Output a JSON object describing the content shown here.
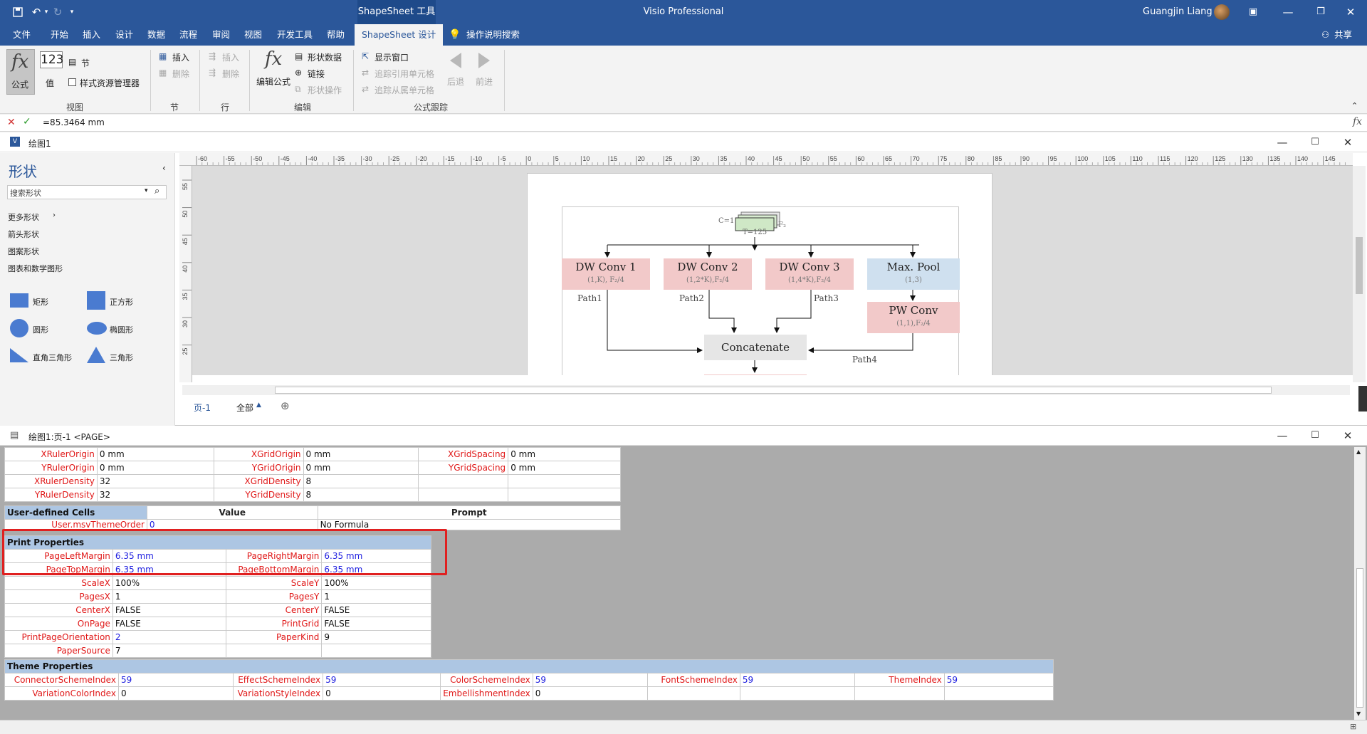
{
  "titlebar": {
    "context_tab": "ShapeSheet 工具",
    "app_title": "Visio Professional",
    "user_name": "Guangjin Liang"
  },
  "menu": {
    "items": [
      "文件",
      "开始",
      "插入",
      "设计",
      "数据",
      "流程",
      "审阅",
      "视图",
      "开发工具",
      "帮助"
    ],
    "active": "ShapeSheet 设计",
    "tell_me": "操作说明搜索",
    "share": "共享"
  },
  "ribbon": {
    "view_group": {
      "formula": "公式",
      "value_icon": "123",
      "value": "值",
      "section": "节",
      "style_explorer": "样式资源管理器",
      "label": "视图"
    },
    "section_group": {
      "insert": "插入",
      "delete": "删除",
      "label": "节"
    },
    "row_group": {
      "insert": "插入",
      "delete": "删除",
      "label": "行"
    },
    "edit_group": {
      "edit_formula": "编辑公式",
      "shape_data": "形状数据",
      "links": "链接",
      "shape_ops": "形状操作",
      "label": "编辑"
    },
    "trace_group": {
      "show_window": "显示窗口",
      "trace_precedents": "追踪引用单元格",
      "trace_dependents": "追踪从属单元格",
      "back": "后退",
      "forward": "前进",
      "label": "公式跟踪"
    }
  },
  "formula_bar": {
    "value": "=85.3464 mm"
  },
  "drawing_window": {
    "title": "绘图1",
    "shapes_panel": {
      "title": "形状",
      "search_placeholder": "搜索形状",
      "links": [
        "更多形状",
        "箭头形状",
        "图案形状",
        "图表和数学图形"
      ],
      "shapes": [
        "矩形",
        "正方形",
        "圆形",
        "椭圆形",
        "直角三角形",
        "三角形"
      ]
    },
    "ruler_labels": [
      "-60",
      "-55",
      "-50",
      "-45",
      "-40",
      "-35",
      "-30",
      "-25",
      "-20",
      "-15",
      "-10",
      "-5",
      "0",
      "5",
      "10",
      "15",
      "20",
      "25",
      "30",
      "35",
      "40",
      "45",
      "50",
      "55",
      "60",
      "65",
      "70",
      "75",
      "80",
      "85",
      "90",
      "95",
      "100",
      "105",
      "110",
      "115",
      "120",
      "125",
      "130",
      "135",
      "140",
      "145"
    ],
    "vruler_labels": [
      "55",
      "50",
      "45",
      "40",
      "35",
      "30",
      "25"
    ],
    "page_tabs": {
      "current": "页-1",
      "all": "全部"
    },
    "diagram": {
      "input_c": "C=1",
      "input_t": "T=125",
      "input_f": "F₂",
      "boxes": [
        {
          "title": "DW Conv 1",
          "sub": "(1,K), F₂/4"
        },
        {
          "title": "DW Conv 2",
          "sub": "(1,2*K),F₂/4"
        },
        {
          "title": "DW Conv 3",
          "sub": "(1,4*K),F₂/4"
        },
        {
          "title": "Max. Pool",
          "sub": "(1,3)"
        },
        {
          "title": "PW Conv",
          "sub": "(1,1),F₂/4"
        }
      ],
      "paths": [
        "Path1",
        "Path2",
        "Path3",
        "Path4"
      ],
      "concat": "Concatenate"
    }
  },
  "shapesheet": {
    "title": "绘图1:页-1 <PAGE>",
    "ruler_grid": [
      [
        "XRulerOrigin",
        "0 mm",
        "XGridOrigin",
        "0 mm",
        "XGridSpacing",
        "0 mm"
      ],
      [
        "YRulerOrigin",
        "0 mm",
        "YGridOrigin",
        "0 mm",
        "YGridSpacing",
        "0 mm"
      ],
      [
        "XRulerDensity",
        "32",
        "XGridDensity",
        "8",
        "",
        ""
      ],
      [
        "YRulerDensity",
        "32",
        "YGridDensity",
        "8",
        "",
        ""
      ]
    ],
    "user_defined": {
      "header": "User-defined Cells",
      "col_value": "Value",
      "col_prompt": "Prompt",
      "row": {
        "name": "User.msvThemeOrder",
        "value": "0",
        "prompt": "No Formula"
      }
    },
    "print_props": {
      "header": "Print Properties",
      "rows": [
        [
          "PageLeftMargin",
          "6.35 mm",
          "PageRightMargin",
          "6.35 mm"
        ],
        [
          "PageTopMargin",
          "6.35 mm",
          "PageBottomMargin",
          "6.35 mm"
        ],
        [
          "ScaleX",
          "100%",
          "ScaleY",
          "100%"
        ],
        [
          "PagesX",
          "1",
          "PagesY",
          "1"
        ],
        [
          "CenterX",
          "FALSE",
          "CenterY",
          "FALSE"
        ],
        [
          "OnPage",
          "FALSE",
          "PrintGrid",
          "FALSE"
        ],
        [
          "PrintPageOrientation",
          "2",
          "PaperKind",
          "9"
        ],
        [
          "PaperSource",
          "7",
          "",
          ""
        ]
      ],
      "blue_values": [
        [
          true,
          true
        ],
        [
          true,
          true
        ],
        [
          false,
          false
        ],
        [
          false,
          false
        ],
        [
          false,
          false
        ],
        [
          false,
          false
        ],
        [
          true,
          false
        ],
        [
          false,
          false
        ]
      ]
    },
    "theme_props": {
      "header": "Theme Properties",
      "rows": [
        [
          "ConnectorSchemeIndex",
          "59",
          "EffectSchemeIndex",
          "59",
          "ColorSchemeIndex",
          "59",
          "FontSchemeIndex",
          "59",
          "ThemeIndex",
          "59"
        ],
        [
          "VariationColorIndex",
          "0",
          "VariationStyleIndex",
          "0",
          "EmbellishmentIndex",
          "0",
          "",
          "",
          "",
          ""
        ]
      ]
    }
  },
  "colors": {
    "accent": "#2b579a",
    "cell_name": "#e01818",
    "formula_blue": "#2020e0",
    "highlight": "#e02020"
  }
}
